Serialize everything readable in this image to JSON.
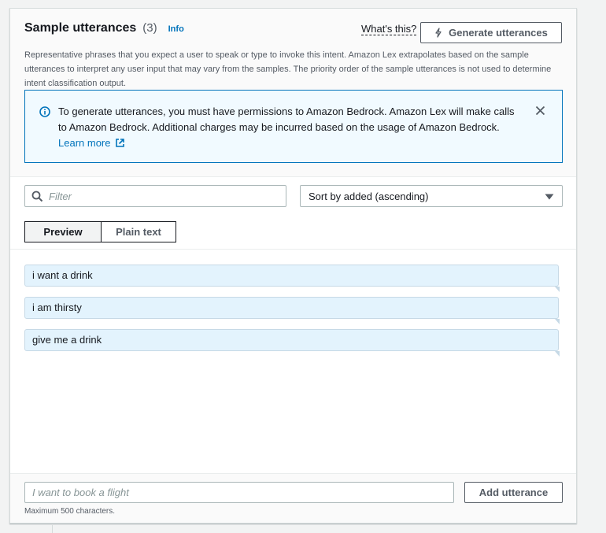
{
  "header": {
    "title": "Sample utterances",
    "count": "(3)",
    "info_link": "Info",
    "whats_this": "What's this?",
    "generate_button": "Generate utterances",
    "description": "Representative phrases that you expect a user to speak or type to invoke this intent. Amazon Lex extrapolates based on the sample utterances to interpret any user input that may vary from the samples. The priority order of the sample utterances is not used to determine intent classification output."
  },
  "alert": {
    "text": "To generate utterances, you must have permissions to Amazon Bedrock. Amazon Lex will make calls to Amazon Bedrock. Additional charges may be incurred based on the usage of Amazon Bedrock.",
    "link": "Learn more"
  },
  "filter": {
    "placeholder": "Filter"
  },
  "sort": {
    "selected": "Sort by added (ascending)"
  },
  "view_toggle": {
    "preview": "Preview",
    "plain_text": "Plain text",
    "active": "preview"
  },
  "utterances": [
    "i want a drink",
    "i am thirsty",
    "give me a drink"
  ],
  "footer": {
    "input_placeholder": "I want to book a flight",
    "add_button": "Add utterance",
    "max_chars": "Maximum 500 characters."
  },
  "colors": {
    "link": "#0073bb",
    "alert_bg": "#f1faff",
    "utterance_bg": "#e3f3fd"
  },
  "icons": [
    "info-icon",
    "lightning-icon",
    "close-icon",
    "external-link-icon",
    "search-icon",
    "caret-down-icon"
  ]
}
